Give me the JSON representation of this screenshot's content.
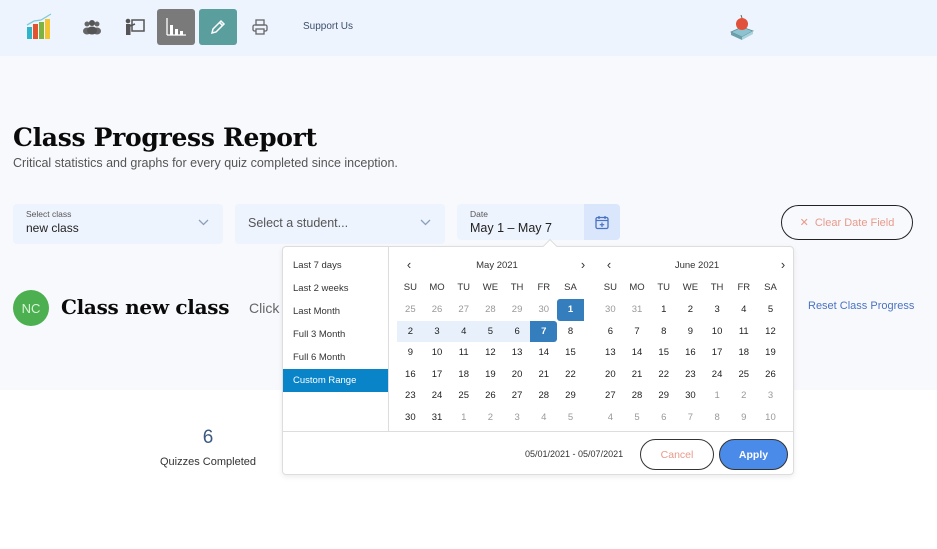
{
  "nav": {
    "support_label": "Support Us",
    "icons": [
      "logo-chart-icon",
      "users-icon",
      "teacher-board-icon",
      "bar-chart-icon",
      "pencil-icon",
      "printer-icon"
    ],
    "colors": {
      "active_report": "#7a7a7a",
      "active_edit": "#5a9e9e"
    }
  },
  "page": {
    "title": "Class Progress Report",
    "subtitle": "Critical statistics and graphs for every quiz completed since inception."
  },
  "filters": {
    "class_label": "Select class",
    "class_value": "new class",
    "student_placeholder": "Select a student...",
    "date_label": "Date",
    "date_value": "May 1 – May 7",
    "clear_label": "Clear Date Field"
  },
  "class_info": {
    "avatar_initials": "NC",
    "name": "Class new class",
    "hint": "Click",
    "reset_label": "Reset Class Progress"
  },
  "stats": {
    "quizzes_completed_value": "6",
    "quizzes_completed_label": "Quizzes Completed"
  },
  "picker": {
    "ranges": [
      "Last 7 days",
      "Last 2 weeks",
      "Last Month",
      "Full 3 Month",
      "Full 6 Month",
      "Custom Range"
    ],
    "active_range": "Custom Range",
    "weekdays": [
      "SU",
      "MO",
      "TU",
      "WE",
      "TH",
      "FR",
      "SA"
    ],
    "left_month": {
      "title": "May 2021",
      "days": [
        [
          "25",
          "26",
          "27",
          "28",
          "29",
          "30",
          "1"
        ],
        [
          "2",
          "3",
          "4",
          "5",
          "6",
          "7",
          "8"
        ],
        [
          "9",
          "10",
          "11",
          "12",
          "13",
          "14",
          "15"
        ],
        [
          "16",
          "17",
          "18",
          "19",
          "20",
          "21",
          "22"
        ],
        [
          "23",
          "24",
          "25",
          "26",
          "27",
          "28",
          "29"
        ],
        [
          "30",
          "31",
          "1",
          "2",
          "3",
          "4",
          "5"
        ]
      ],
      "off": [
        [
          0,
          0
        ],
        [
          0,
          1
        ],
        [
          0,
          2
        ],
        [
          0,
          3
        ],
        [
          0,
          4
        ],
        [
          0,
          5
        ],
        [
          5,
          2
        ],
        [
          5,
          3
        ],
        [
          5,
          4
        ],
        [
          5,
          5
        ],
        [
          5,
          6
        ]
      ]
    },
    "right_month": {
      "title": "June 2021",
      "days": [
        [
          "30",
          "31",
          "1",
          "2",
          "3",
          "4",
          "5"
        ],
        [
          "6",
          "7",
          "8",
          "9",
          "10",
          "11",
          "12"
        ],
        [
          "13",
          "14",
          "15",
          "16",
          "17",
          "18",
          "19"
        ],
        [
          "20",
          "21",
          "22",
          "23",
          "24",
          "25",
          "26"
        ],
        [
          "27",
          "28",
          "29",
          "30",
          "1",
          "2",
          "3"
        ],
        [
          "4",
          "5",
          "6",
          "7",
          "8",
          "9",
          "10"
        ]
      ],
      "off": [
        [
          0,
          0
        ],
        [
          0,
          1
        ],
        [
          4,
          4
        ],
        [
          4,
          5
        ],
        [
          4,
          6
        ],
        [
          5,
          0
        ],
        [
          5,
          1
        ],
        [
          5,
          2
        ],
        [
          5,
          3
        ],
        [
          5,
          4
        ],
        [
          5,
          5
        ],
        [
          5,
          6
        ]
      ]
    },
    "selection": {
      "start": "May 1, 2021",
      "end": "May 7, 2021"
    },
    "range_text": "05/01/2021 - 05/07/2021",
    "cancel_label": "Cancel",
    "apply_label": "Apply"
  }
}
